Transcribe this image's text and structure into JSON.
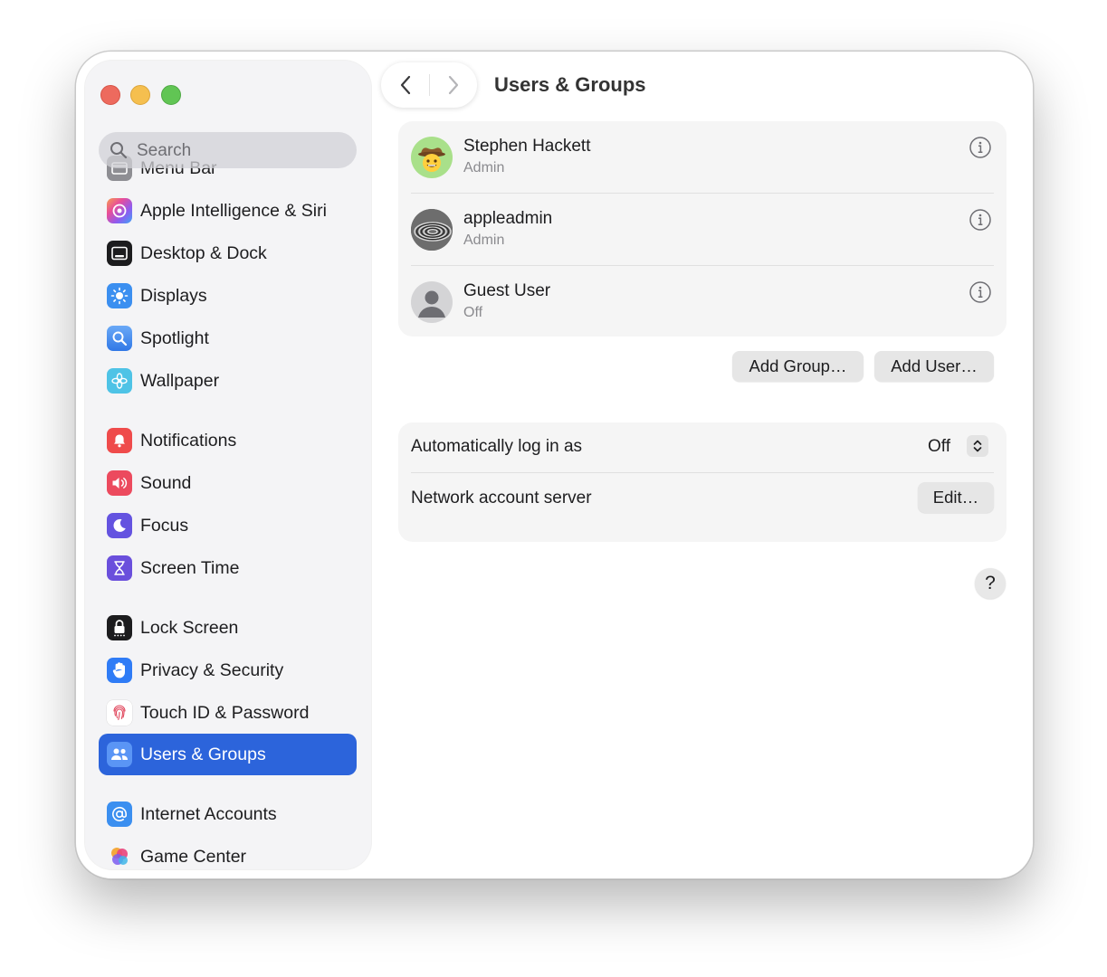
{
  "window": {
    "title": "Users & Groups"
  },
  "sidebar": {
    "search_placeholder": "Search",
    "items": [
      {
        "label": "Menu Bar",
        "icon": "menu-bar-icon"
      },
      {
        "label": "Apple Intelligence & Siri",
        "icon": "apple-intelligence-icon"
      },
      {
        "label": "Desktop & Dock",
        "icon": "desktop-dock-icon"
      },
      {
        "label": "Displays",
        "icon": "displays-icon"
      },
      {
        "label": "Spotlight",
        "icon": "spotlight-icon"
      },
      {
        "label": "Wallpaper",
        "icon": "wallpaper-icon"
      },
      {
        "label": "Notifications",
        "icon": "notifications-icon"
      },
      {
        "label": "Sound",
        "icon": "sound-icon"
      },
      {
        "label": "Focus",
        "icon": "focus-icon"
      },
      {
        "label": "Screen Time",
        "icon": "screen-time-icon"
      },
      {
        "label": "Lock Screen",
        "icon": "lock-screen-icon"
      },
      {
        "label": "Privacy & Security",
        "icon": "privacy-hand-icon"
      },
      {
        "label": "Touch ID & Password",
        "icon": "fingerprint-icon"
      },
      {
        "label": "Users & Groups",
        "icon": "users-icon",
        "selected": true
      },
      {
        "label": "Internet Accounts",
        "icon": "at-sign-icon"
      },
      {
        "label": "Game Center",
        "icon": "game-center-icon"
      }
    ]
  },
  "users": [
    {
      "name": "Stephen Hackett",
      "role": "Admin",
      "avatar": "cowboy-emoji-avatar"
    },
    {
      "name": "appleadmin",
      "role": "Admin",
      "avatar": "swirl-photo-avatar"
    },
    {
      "name": "Guest User",
      "role": "Off",
      "avatar": "guest-silhouette-avatar"
    }
  ],
  "actions": {
    "add_group": "Add Group…",
    "add_user": "Add User…"
  },
  "settings": {
    "auto_login_label": "Automatically log in as",
    "auto_login_value": "Off",
    "network_server_label": "Network account server",
    "edit_button": "Edit…"
  },
  "help": {
    "label": "?"
  },
  "colors": {
    "accent": "#2c64db",
    "close": "#ed6a5e",
    "minimize": "#f5bf4f",
    "maximize": "#61c554"
  }
}
